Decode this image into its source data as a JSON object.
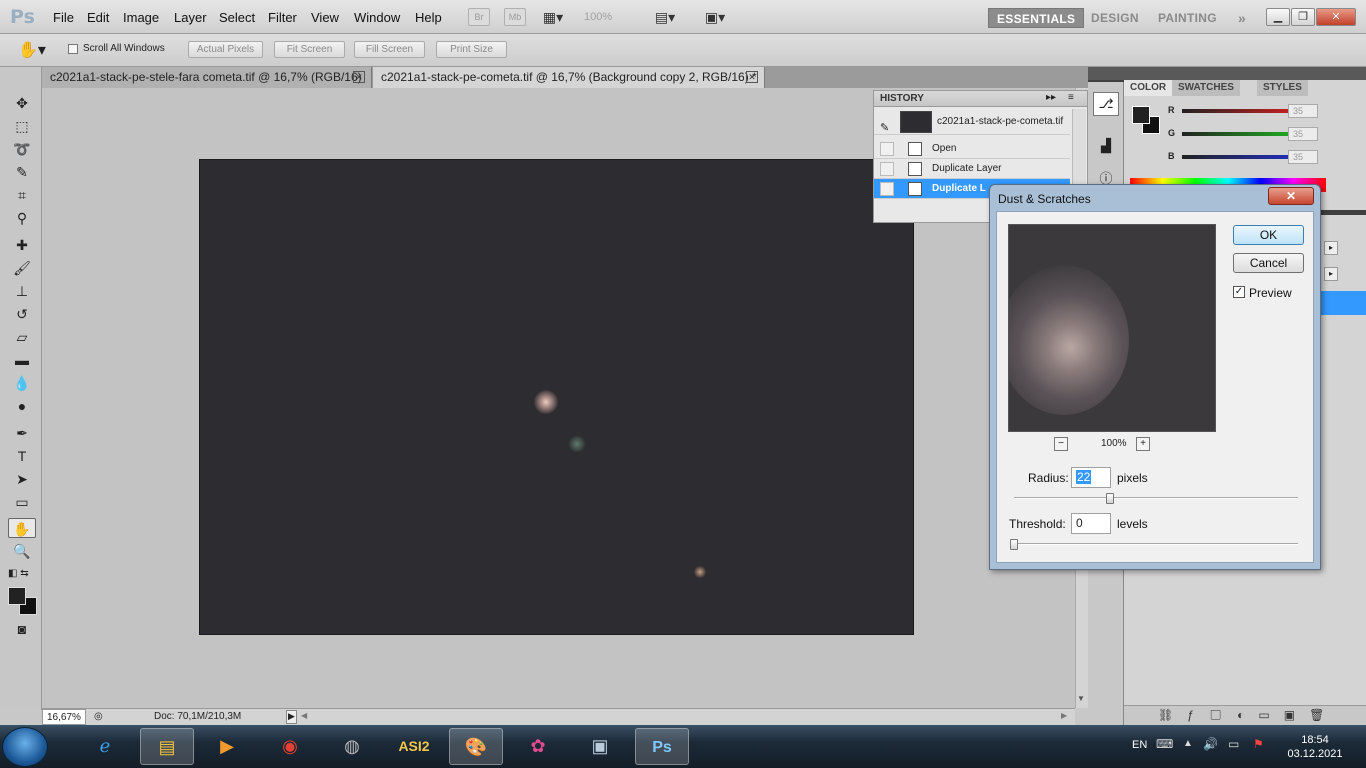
{
  "app": {
    "logo": "Ps",
    "menu": [
      "File",
      "Edit",
      "Image",
      "Layer",
      "Select",
      "Filter",
      "View",
      "Window",
      "Help"
    ],
    "bridge": "Br",
    "mini_bridge": "Mb",
    "zoom_level": "100%",
    "workspaces": [
      "ESSENTIALS",
      "DESIGN",
      "PAINTING"
    ],
    "more_workspaces": "»"
  },
  "options": {
    "scroll_all_label": "Scroll All Windows",
    "buttons": [
      "Actual Pixels",
      "Fit Screen",
      "Fill Screen",
      "Print Size"
    ]
  },
  "tabs": [
    {
      "label": "c2021a1-stack-pe-stele-fara cometa.tif @ 16,7% (RGB/16)",
      "active": false
    },
    {
      "label": "c2021a1-stack-pe-cometa.tif @ 16,7% (Background copy 2, RGB/16) *",
      "active": true
    }
  ],
  "status": {
    "zoom": "16,67%",
    "doc": "Doc: 70,1M/210,3M"
  },
  "history": {
    "title": "HISTORY",
    "snapshot": "c2021a1-stack-pe-cometa.tif",
    "items": [
      "Open",
      "Duplicate Layer",
      "Duplicate L"
    ]
  },
  "color_panel": {
    "tabs": [
      "COLOR",
      "SWATCHES",
      "STYLES"
    ],
    "channels": [
      {
        "name": "R",
        "value": "35",
        "color": "#e02020"
      },
      {
        "name": "G",
        "value": "35",
        "color": "#20c020"
      },
      {
        "name": "B",
        "value": "35",
        "color": "#2030d0"
      }
    ]
  },
  "dialog": {
    "title": "Dust & Scratches",
    "ok": "OK",
    "cancel": "Cancel",
    "preview_label": "Preview",
    "preview_checked": true,
    "zoom": "100%",
    "zoom_minus": "−",
    "zoom_plus": "+",
    "radius_label": "Radius:",
    "radius_value": "22",
    "radius_unit": "pixels",
    "threshold_label": "Threshold:",
    "threshold_value": "0",
    "threshold_unit": "levels"
  },
  "taskbar": {
    "lang": "EN",
    "time": "18:54",
    "date": "03.12.2021",
    "apps": [
      "ie",
      "explorer",
      "media",
      "chrome",
      "planet",
      "asi",
      "paint",
      "flower",
      "app",
      "photoshop"
    ]
  },
  "colors": {
    "accent": "#3399ff",
    "canvas": "#2d2c30",
    "dock": "#3f3f3f"
  }
}
